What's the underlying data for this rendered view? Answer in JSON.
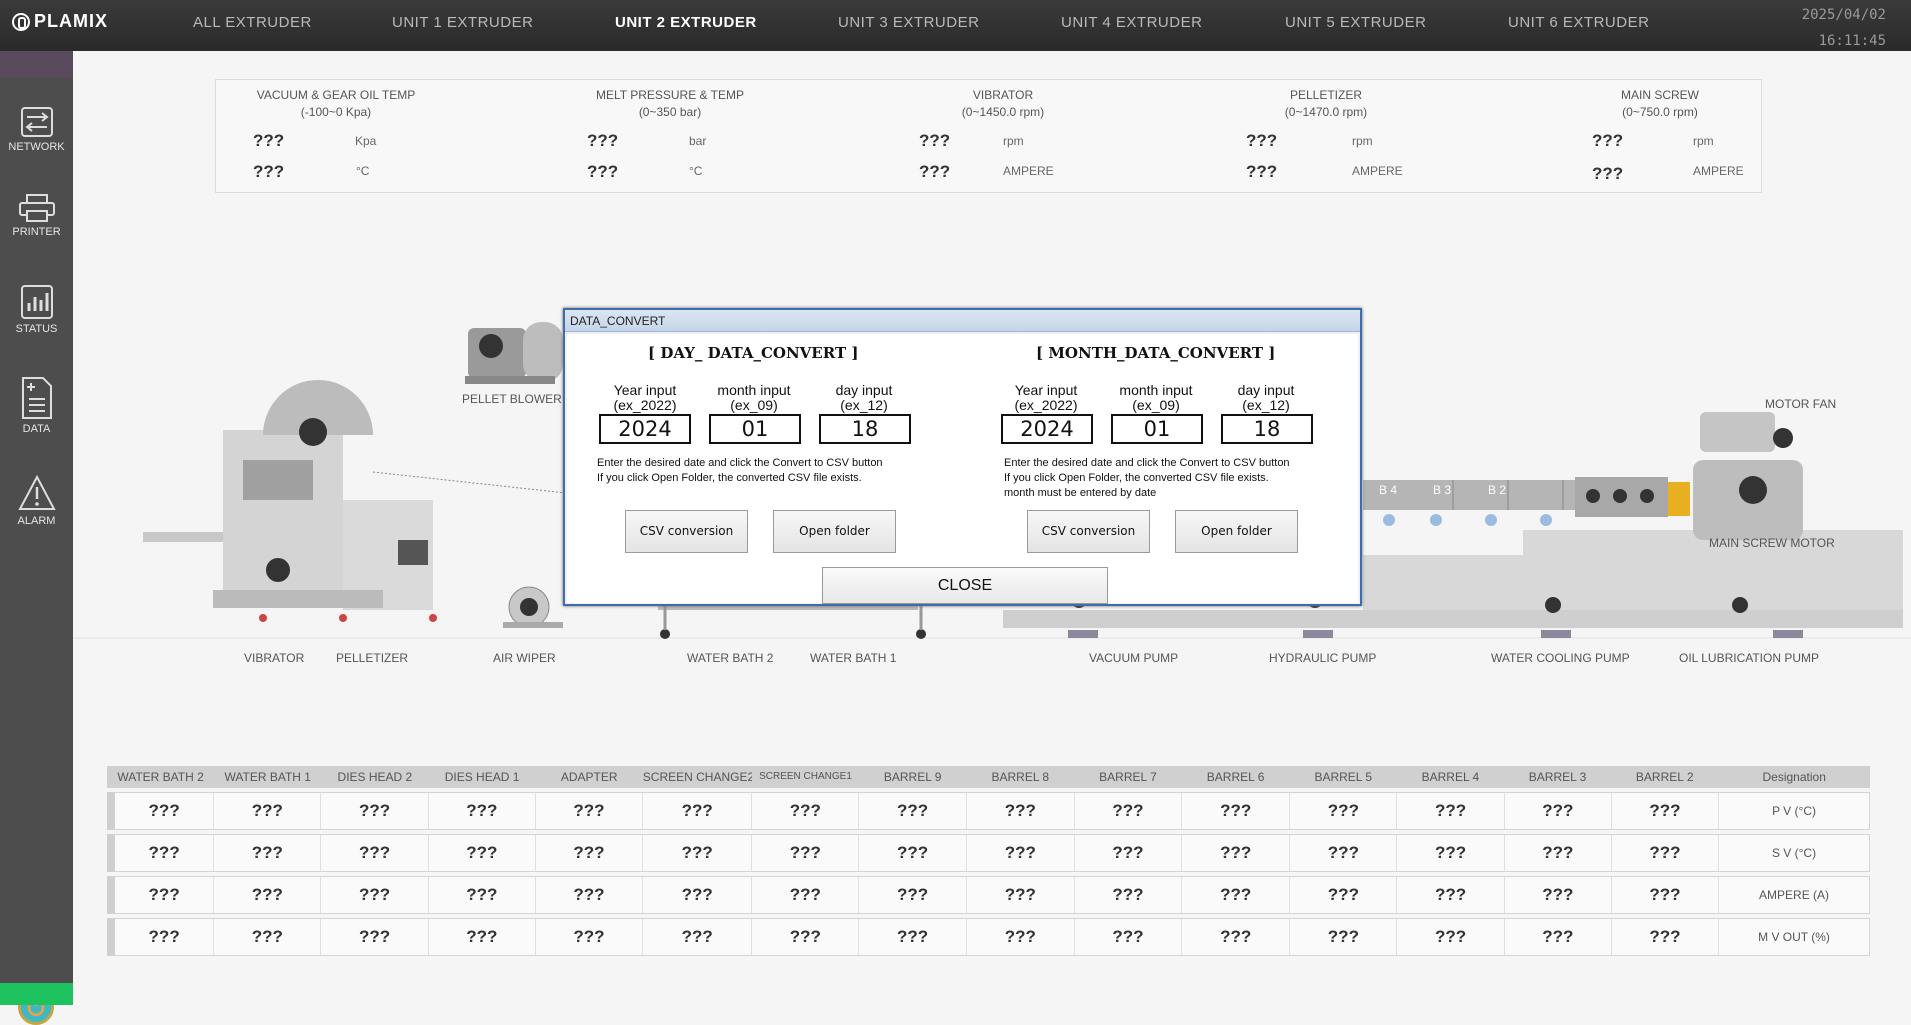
{
  "header": {
    "logo": "PLAMIX",
    "tabs": [
      {
        "label": "ALL  EXTRUDER",
        "active": false
      },
      {
        "label": "UNIT 1  EXTRUDER",
        "active": false
      },
      {
        "label": "UNIT 2  EXTRUDER",
        "active": true
      },
      {
        "label": "UNIT 3  EXTRUDER",
        "active": false
      },
      {
        "label": "UNIT 4  EXTRUDER",
        "active": false
      },
      {
        "label": "UNIT 5  EXTRUDER",
        "active": false
      },
      {
        "label": "UNIT 6  EXTRUDER",
        "active": false
      }
    ],
    "date": "2025/04/02",
    "time": "16:11:45"
  },
  "sidebar": {
    "items": [
      {
        "label": "NETWORK",
        "icon": "network-icon"
      },
      {
        "label": "PRINTER",
        "icon": "printer-icon"
      },
      {
        "label": "STATUS",
        "icon": "status-icon"
      },
      {
        "label": "DATA",
        "icon": "data-icon"
      },
      {
        "label": "ALARM",
        "icon": "alarm-icon"
      }
    ]
  },
  "measurements": [
    {
      "title": "VACUUM & GEAR OIL TEMP",
      "range": "(-100~0 Kpa)",
      "v1": "???",
      "u1": "Kpa",
      "v2": "???",
      "u2": "°C"
    },
    {
      "title": "MELT  PRESSURE & TEMP",
      "range": "(0~350 bar)",
      "v1": "???",
      "u1": "bar",
      "v2": "???",
      "u2": "°C"
    },
    {
      "title": "VIBRATOR",
      "range": "(0~1450.0 rpm)",
      "v1": "???",
      "u1": "rpm",
      "v2": "???",
      "u2": "AMPERE"
    },
    {
      "title": "PELLETIZER",
      "range": "(0~1470.0 rpm)",
      "v1": "???",
      "u1": "rpm",
      "v2": "???",
      "u2": "AMPERE"
    },
    {
      "title": "MAIN SCREW",
      "range": "(0~750.0 rpm)",
      "v1": "???",
      "u1": "rpm",
      "v2": "???",
      "u2": "AMPERE"
    }
  ],
  "machine": {
    "pellet_blower": "PELLET BLOWER",
    "motor_fan": "MOTOR FAN",
    "main_screw_motor": "MAIN SCREW MOTOR",
    "barrels": [
      "B 4",
      "B 3",
      "B 2"
    ],
    "bottom_labels": [
      "VIBRATOR",
      "PELLETIZER",
      "AIR WIPER",
      "WATER BATH 2",
      "WATER BATH 1",
      "VACUUM PUMP",
      "HYDRAULIC PUMP",
      "WATER COOLING PUMP",
      "OIL LUBRICATION PUMP"
    ]
  },
  "table": {
    "headers": [
      "WATER BATH 2",
      "WATER BATH 1",
      "DIES HEAD 2",
      "DIES HEAD 1",
      "ADAPTER",
      "SCREEN CHANGE2",
      "SCREEN CHANGE1",
      "BARREL 9",
      "BARREL 8",
      "BARREL 7",
      "BARREL 6",
      "BARREL 5",
      "BARREL 4",
      "BARREL 3",
      "BARREL 2",
      "Designation"
    ],
    "rows": [
      {
        "designation": "P  V  (°C)",
        "values": [
          "???",
          "???",
          "???",
          "???",
          "???",
          "???",
          "???",
          "???",
          "???",
          "???",
          "???",
          "???",
          "???",
          "???",
          "???"
        ]
      },
      {
        "designation": "S  V  (°C)",
        "values": [
          "???",
          "???",
          "???",
          "???",
          "???",
          "???",
          "???",
          "???",
          "???",
          "???",
          "???",
          "???",
          "???",
          "???",
          "???"
        ]
      },
      {
        "designation": "AMPERE (A)",
        "values": [
          "???",
          "???",
          "???",
          "???",
          "???",
          "???",
          "???",
          "???",
          "???",
          "???",
          "???",
          "???",
          "???",
          "???",
          "???"
        ]
      },
      {
        "designation": "M V OUT (%)",
        "values": [
          "???",
          "???",
          "???",
          "???",
          "???",
          "???",
          "???",
          "???",
          "???",
          "???",
          "???",
          "???",
          "???",
          "???",
          "???"
        ]
      }
    ]
  },
  "dialog": {
    "title": "DATA_CONVERT",
    "day": {
      "heading": "[ DAY_ DATA_CONVERT  ]",
      "year_label": "Year input",
      "year_hint": "(ex_2022)",
      "month_label": "month input",
      "month_hint": "(ex_09)",
      "day_label": "day input",
      "day_hint": "(ex_12)",
      "year_value": "2024",
      "month_value": "01",
      "day_value": "18",
      "note1": "Enter the desired date and click the Convert to CSV button",
      "note2": "If you click Open Folder, the converted CSV file exists.",
      "csv_button": "CSV conversion",
      "open_button": "Open folder"
    },
    "month": {
      "heading": "[ MONTH_DATA_CONVERT  ]",
      "year_label": "Year input",
      "year_hint": "(ex_2022)",
      "month_label": "month input",
      "month_hint": "(ex_09)",
      "day_label": "day input",
      "day_hint": "(ex_12)",
      "year_value": "2024",
      "month_value": "01",
      "day_value": "18",
      "note1": "Enter the desired date and click the Convert to CSV button",
      "note2": "If you click Open Folder, the converted CSV file exists.",
      "note3": "month must be entered by date",
      "csv_button": "CSV conversion",
      "open_button": "Open folder"
    },
    "close_button": "CLOSE"
  },
  "colors": {
    "topbar": "#2f2f2f",
    "sidebar": "#4d4d4d",
    "dialog_border": "#3e6ea9",
    "power_button": "#3fb7c4",
    "status_strip": "#1ec25e"
  }
}
